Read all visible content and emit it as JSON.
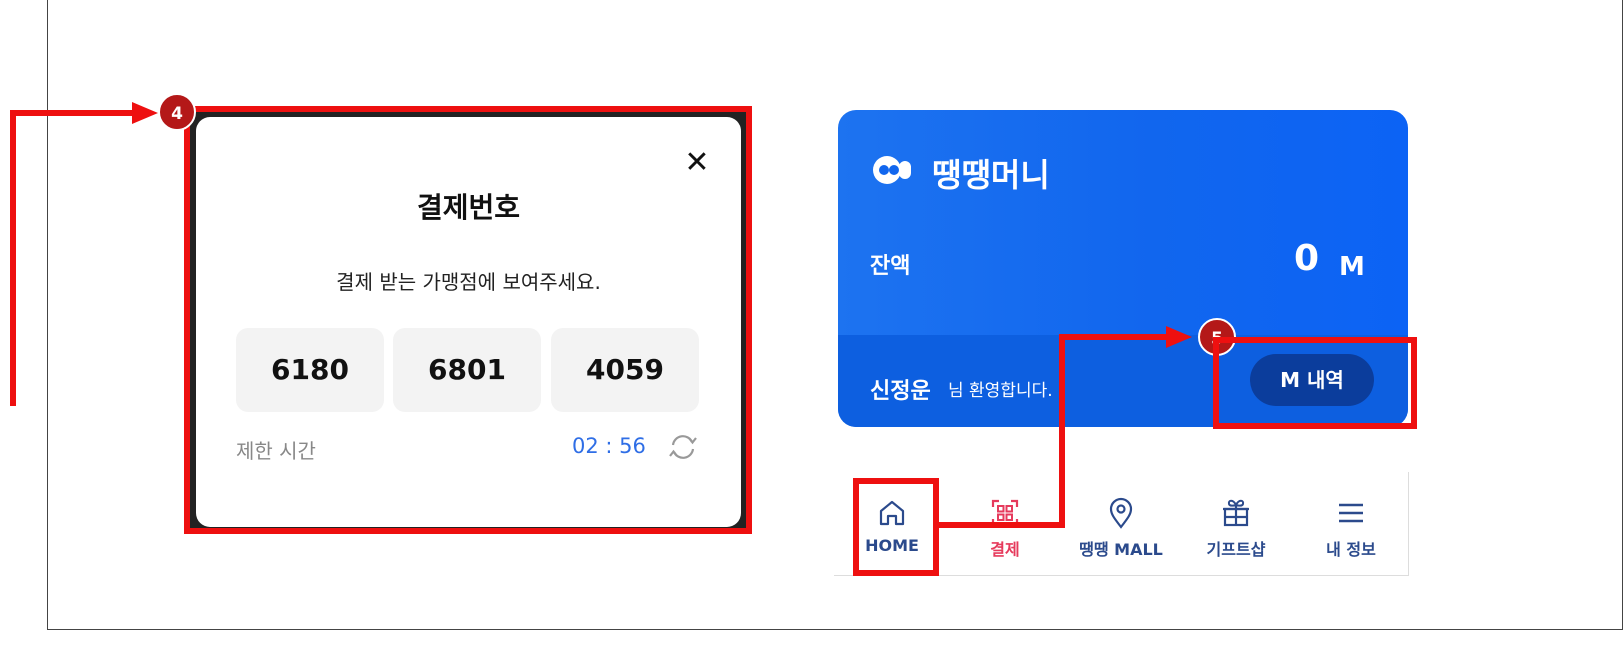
{
  "modal": {
    "title": "결제번호",
    "subtitle": "결제 받는 가맹점에 보여주세요.",
    "codes": [
      "6180",
      "6801",
      "4059"
    ],
    "limit_label": "제한 시간",
    "timer": "02 : 56",
    "close_icon": "close-icon",
    "refresh_icon": "refresh-icon"
  },
  "card": {
    "brand": "땡땡머니",
    "balance_label": "잔액",
    "balance_value": "0",
    "balance_unit": "M",
    "user_name": "신정운",
    "welcome": "님 환영합니다.",
    "history_button": "M 내역"
  },
  "nav": {
    "items": [
      {
        "label": "HOME",
        "icon": "home-icon",
        "color": "#2b4a8c"
      },
      {
        "label": "결제",
        "icon": "qr-scan-icon",
        "color": "#e63a5c"
      },
      {
        "label": "땡땡 MALL",
        "icon": "location-pin-icon",
        "color": "#2b4a8c"
      },
      {
        "label": "기프트샵",
        "icon": "gift-icon",
        "color": "#2b4a8c"
      },
      {
        "label": "내 정보",
        "icon": "menu-icon",
        "color": "#2b4a8c"
      }
    ]
  },
  "callouts": {
    "badge_4": "4",
    "badge_5": "5"
  },
  "colors": {
    "callout_red": "#ee1010",
    "badge_red": "#b41818",
    "card_blue": "#1166ee",
    "button_navy": "#0b3d9c",
    "timer_blue": "#2f6ee6"
  }
}
